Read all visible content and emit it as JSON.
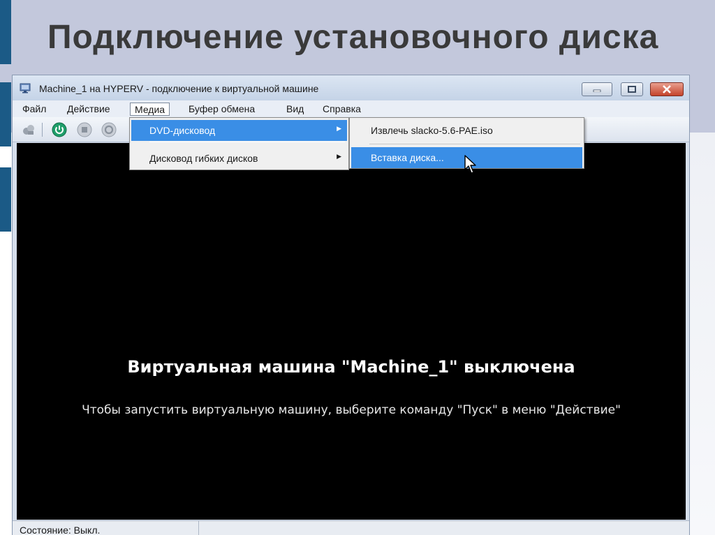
{
  "slide": {
    "title": "Подключение установочного диска"
  },
  "window": {
    "title": "Machine_1 на HYPERV - подключение к виртуальной машине",
    "controls": [
      "minimize",
      "maximize",
      "close"
    ]
  },
  "menubar": {
    "items": [
      {
        "label": "Файл"
      },
      {
        "label": "Действие"
      },
      {
        "label": "Медиа",
        "active": true
      },
      {
        "label": "Буфер обмена"
      },
      {
        "label": "Вид"
      },
      {
        "label": "Справка"
      }
    ]
  },
  "media_menu": {
    "items": [
      {
        "label": "DVD-дисковод",
        "highlighted": true,
        "has_submenu": true
      },
      {
        "label": "Дисковод гибких дисков",
        "has_submenu": true
      }
    ]
  },
  "dvd_submenu": {
    "items": [
      {
        "label": "Извлечь slacko-5.6-PAE.iso"
      },
      {
        "label": "Вставка диска...",
        "highlighted": true
      }
    ]
  },
  "vm_screen": {
    "message": "Виртуальная машина \"Machine_1\" выключена",
    "hint": "Чтобы запустить виртуальную машину, выберите команду \"Пуск\" в меню \"Действие\""
  },
  "statusbar": {
    "text": "Состояние: Выкл."
  },
  "toolbar": {
    "icons": [
      "ctrl-alt-del-icon",
      "start-icon",
      "turn-off-icon",
      "shutdown-icon"
    ]
  },
  "colors": {
    "highlight": "#3a8ee6",
    "slide_accent": "#1b5a86",
    "start_green": "#1f9e6a"
  }
}
